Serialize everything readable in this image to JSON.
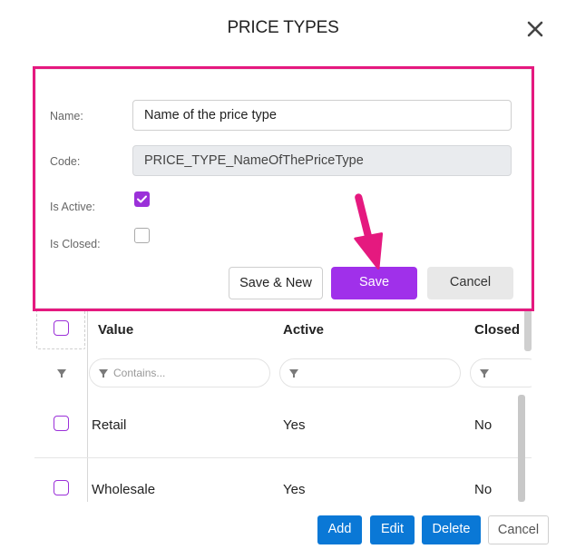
{
  "dialog": {
    "title": "PRICE TYPES",
    "close_icon": "close-icon"
  },
  "form": {
    "name_label": "Name:",
    "name_value": "Name of the price type",
    "code_label": "Code:",
    "code_value": "PRICE_TYPE_NameOfThePriceType",
    "is_active_label": "Is Active:",
    "is_active": true,
    "is_closed_label": "Is Closed:",
    "is_closed": false,
    "save_new_label": "Save & New",
    "save_label": "Save",
    "cancel_label": "Cancel"
  },
  "grid": {
    "columns": [
      "Value",
      "Active",
      "Closed"
    ],
    "filter_placeholder": "Contains...",
    "rows": [
      {
        "value": "Retail",
        "active": "Yes",
        "closed": "No"
      },
      {
        "value": "Wholesale",
        "active": "Yes",
        "closed": "No"
      }
    ]
  },
  "footer": {
    "add_label": "Add",
    "edit_label": "Edit",
    "delete_label": "Delete",
    "cancel_label": "Cancel"
  },
  "colors": {
    "accent_purple": "#a030ea",
    "highlight_pink": "#e5197f",
    "primary_blue": "#0a78d6"
  }
}
